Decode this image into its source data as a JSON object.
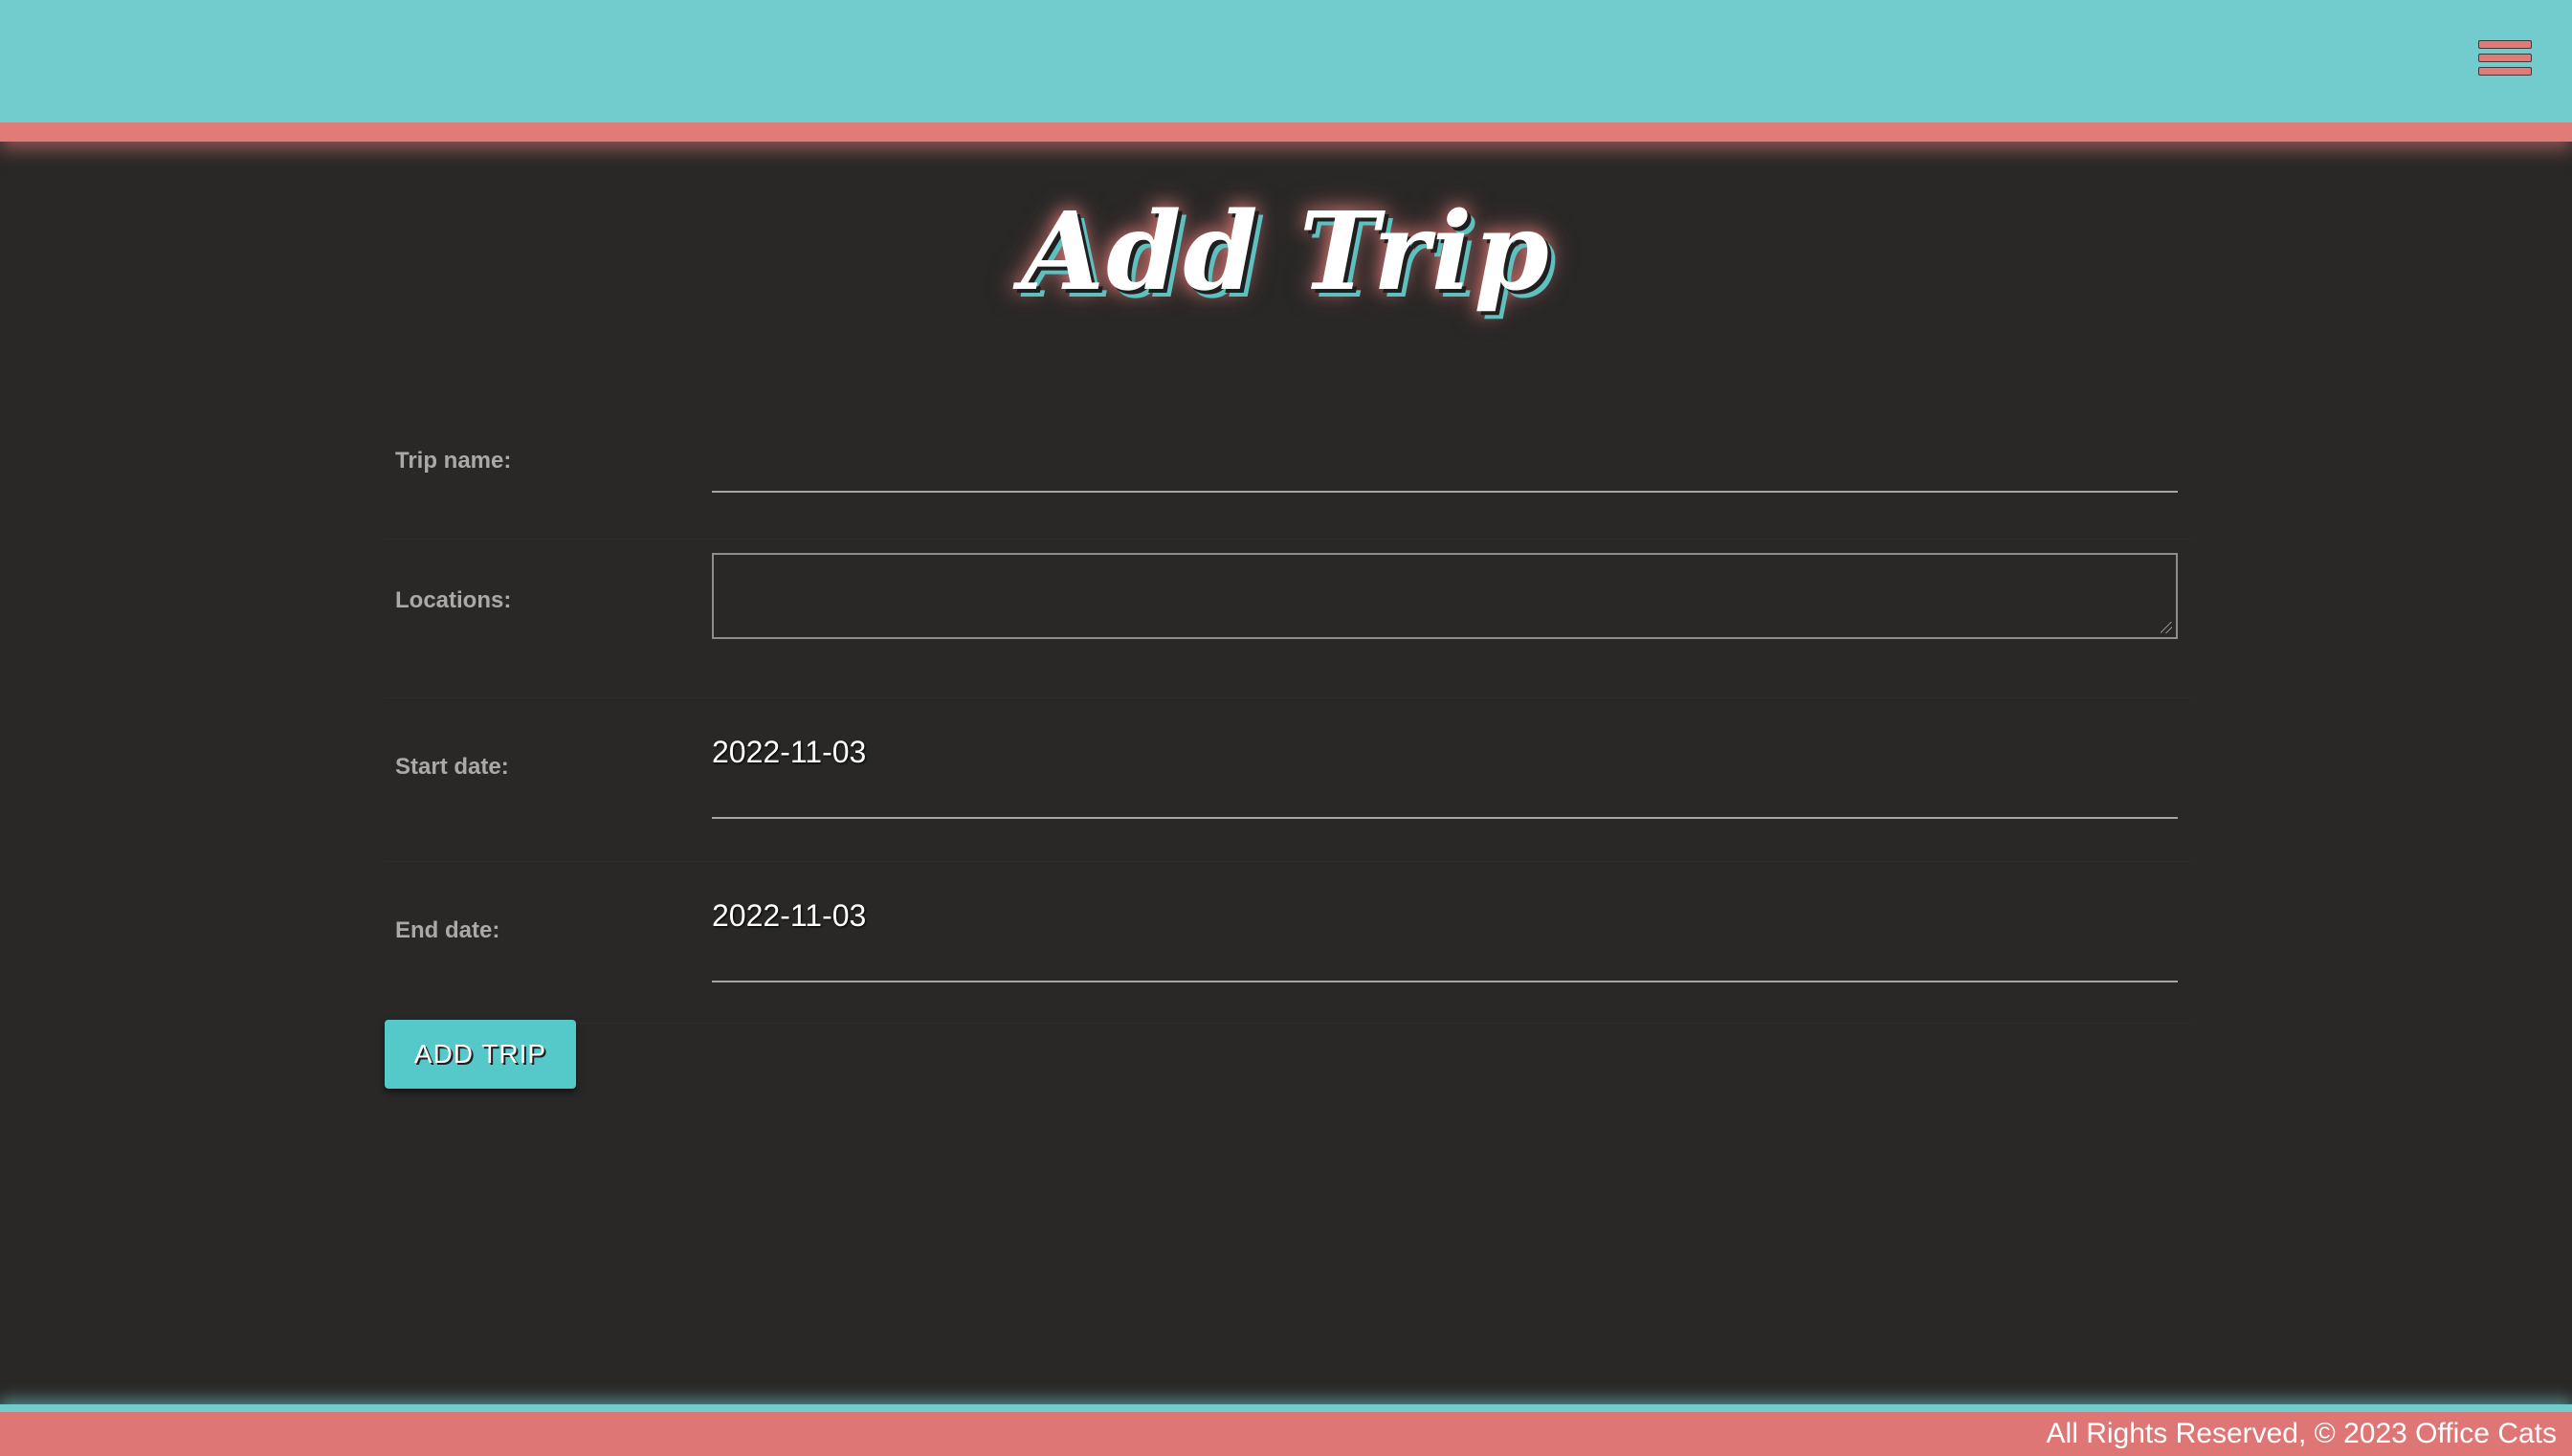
{
  "header": {
    "menu_icon": "hamburger-menu-icon"
  },
  "page": {
    "title": "Add Trip"
  },
  "form": {
    "trip_name_label": "Trip name:",
    "trip_name_value": "",
    "locations_label": "Locations:",
    "locations_value": "",
    "start_date_label": "Start date:",
    "start_date_value": "2022-11-03",
    "end_date_label": "End date:",
    "end_date_value": "2022-11-03",
    "submit_label": "ADD TRIP"
  },
  "footer": {
    "text": "All Rights Reserved, © 2023 Office Cats"
  },
  "colors": {
    "header_bg": "#72cbcc",
    "accent": "#e07b78",
    "page_bg": "#292827",
    "button_bg": "#55c8c9"
  }
}
